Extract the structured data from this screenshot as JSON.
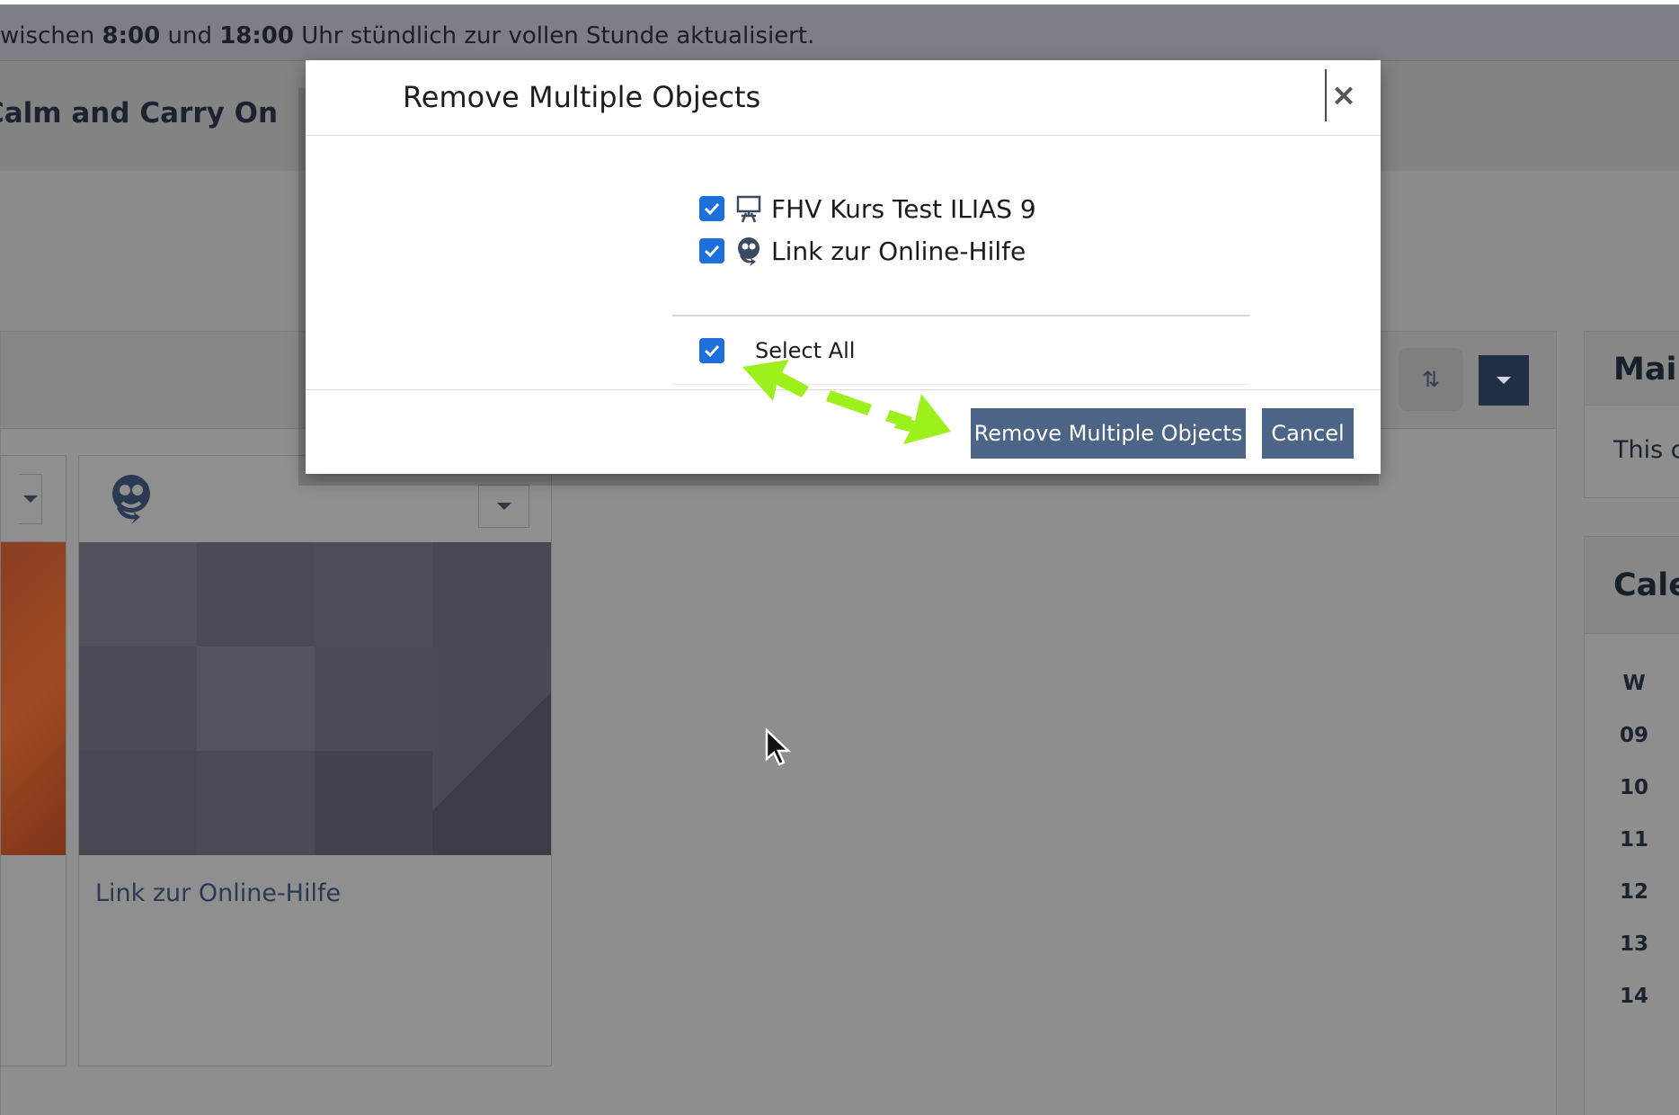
{
  "info_bar": {
    "text_1": "wischen ",
    "time_start": "8:00",
    "text_2": " und ",
    "time_end": "18:00",
    "text_3": " Uhr stündlich zur vollen Stunde aktualisiert."
  },
  "header": {
    "title": "Calm and Carry On"
  },
  "cards": [
    {
      "title": "Link zur Online-Hilfe",
      "icon": "help-link-icon"
    }
  ],
  "side": {
    "mail_title": "Mail",
    "mail_body": "This c",
    "calendar_title": "Cale",
    "week_label": "W",
    "weeks": [
      "09",
      "10",
      "11",
      "12",
      "13",
      "14"
    ]
  },
  "modal": {
    "title": "Remove Multiple Objects",
    "close_label": "×",
    "items": [
      {
        "label": "FHV Kurs Test ILIAS 9",
        "checked": true,
        "icon": "course-icon"
      },
      {
        "label": "Link zur Online-Hilfe",
        "checked": true,
        "icon": "web-link-icon"
      }
    ],
    "select_all_label": "Select All",
    "primary_button": "Remove Multiple Objects",
    "cancel_button": "Cancel"
  },
  "colors": {
    "primary": "#4c6586",
    "checkbox": "#1e6fd9",
    "annotation_arrow": "#9cf01c"
  }
}
